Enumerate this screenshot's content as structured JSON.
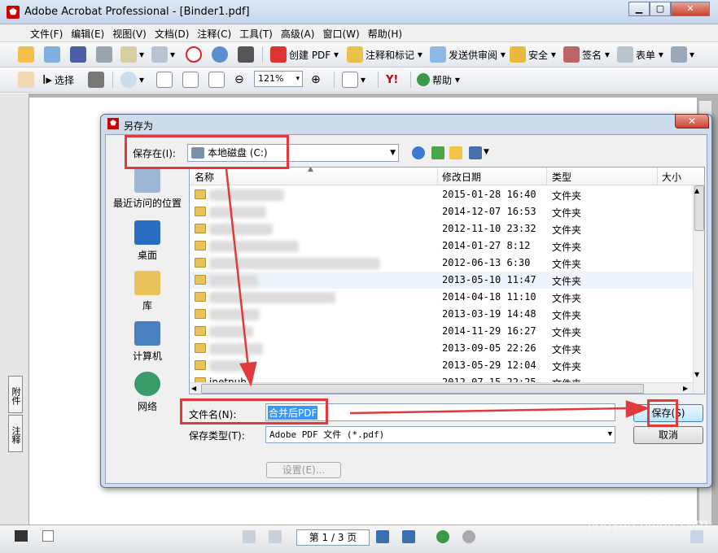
{
  "app": {
    "title": "Adobe Acrobat Professional - [Binder1.pdf]",
    "icon": "acrobat-icon"
  },
  "menubar": {
    "items": [
      "文件(F)",
      "编辑(E)",
      "视图(V)",
      "文档(D)",
      "注释(C)",
      "工具(T)",
      "高级(A)",
      "窗口(W)",
      "帮助(H)"
    ]
  },
  "toolbar1": {
    "create_pdf": "创建 PDF",
    "comment_markup": "注释和标记",
    "send_review": "发送供审阅",
    "security": "安全",
    "sign": "签名",
    "forms": "表单"
  },
  "toolbar2": {
    "select": "选择",
    "zoom": "121%",
    "help": "帮助"
  },
  "left_tabs": [
    "附件",
    "注释"
  ],
  "statusbar": {
    "page": "第 1 / 3 页"
  },
  "dialog": {
    "title": "另存为",
    "save_in_label": "保存在(I):",
    "save_in_value": "本地磁盘 (C:)",
    "places": [
      "最近访问的位置",
      "桌面",
      "库",
      "计算机",
      "网络"
    ],
    "columns": [
      "名称",
      "修改日期",
      "类型",
      "大小"
    ],
    "rows": [
      {
        "date": "2015-01-28 16:40",
        "type": "文件夹"
      },
      {
        "date": "2014-12-07 16:53",
        "type": "文件夹"
      },
      {
        "date": "2012-11-10 23:32",
        "type": "文件夹"
      },
      {
        "date": "2014-01-27 8:12",
        "type": "文件夹"
      },
      {
        "date": "2012-06-13 6:30",
        "type": "文件夹"
      },
      {
        "date": "2013-05-10 11:47",
        "type": "文件夹"
      },
      {
        "date": "2014-04-18 11:10",
        "type": "文件夹"
      },
      {
        "date": "2013-03-19 14:48",
        "type": "文件夹"
      },
      {
        "date": "2014-11-29 16:27",
        "type": "文件夹"
      },
      {
        "date": "2013-09-05 22:26",
        "type": "文件夹"
      },
      {
        "date": "2013-05-29 12:04",
        "type": "文件夹"
      },
      {
        "name": "inetpub",
        "date": "2012-07-15 22:25",
        "type": "文件夹"
      }
    ],
    "filename_label": "文件名(N):",
    "filename_value": "合并后PDF",
    "filetype_label": "保存类型(T):",
    "filetype_value": "Adobe PDF 文件 (*.pdf)",
    "save_button": "保存(S)",
    "cancel_button": "取消",
    "settings_button": "设置(E)..."
  },
  "watermark": {
    "text": "Baidu经验",
    "url_text": "jingyan.baidu.com"
  },
  "colors": {
    "annotation_red": "#e23a3a",
    "selection_blue": "#3399ff"
  }
}
